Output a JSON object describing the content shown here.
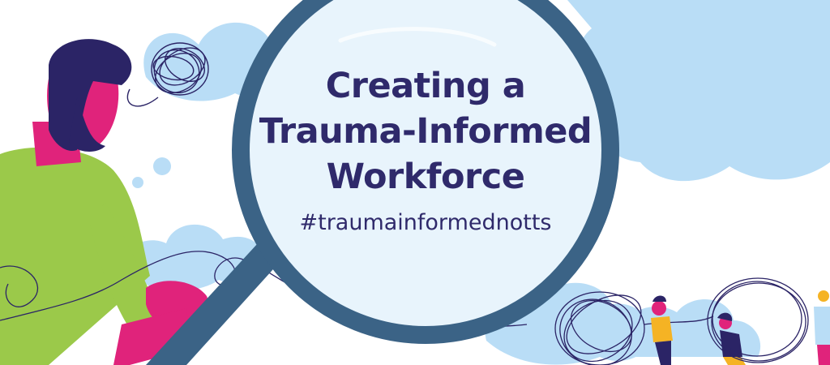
{
  "banner": {
    "title_lines": [
      "Creating a",
      "Trauma-Informed",
      "Workforce"
    ],
    "hashtag": "#traumainformednotts"
  },
  "colors": {
    "text_navy": "#2f2a6b",
    "lens_ring": "#3b6386",
    "lens_fill": "#e8f4fc",
    "cloud_blue": "#b9ddf6",
    "cloud_light": "#d6ecfa",
    "skin_magenta": "#e0237b",
    "shirt_green": "#9bc94a",
    "hair_navy": "#2b2466",
    "shirt_yellow": "#f5b324",
    "thread_navy": "#2b2466"
  },
  "icons": [
    "magnifying-glass-icon",
    "tangled-thread-icon",
    "thought-bubble-icon"
  ]
}
